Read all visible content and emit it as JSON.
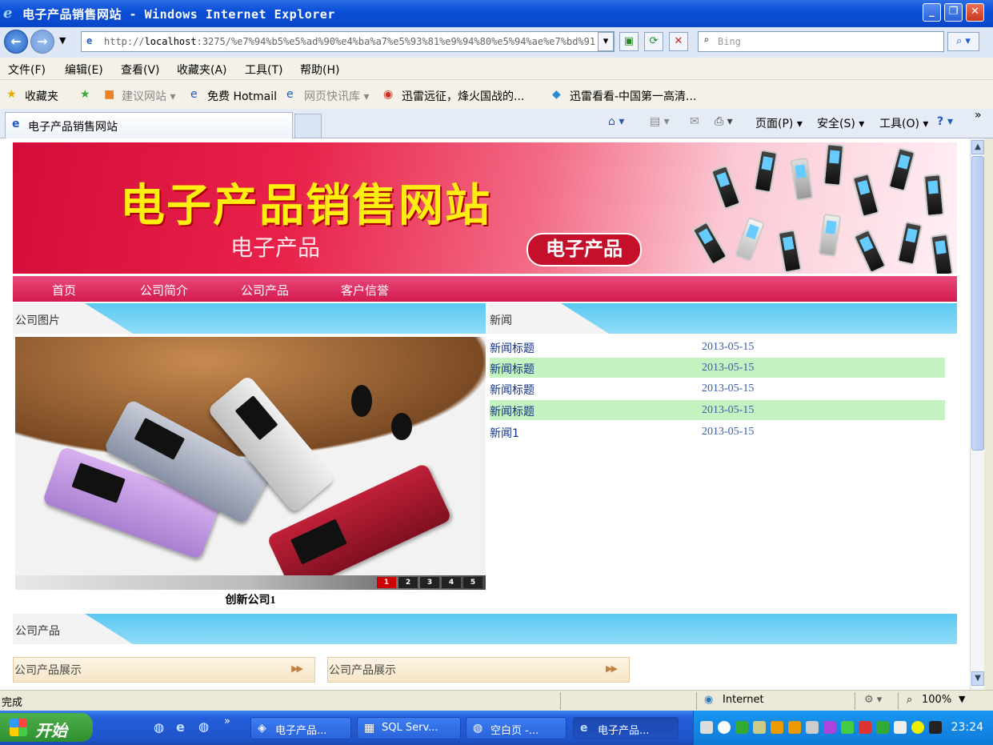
{
  "window": {
    "title": "电子产品销售网站 - Windows Internet Explorer"
  },
  "address": {
    "url_prefix": "http://",
    "url_host": "localhost",
    "url_rest": ":3275/%e7%94%b5%e5%ad%90%e4%ba%a7%e5%93%81%e9%94%80%e5%94%ae%e7%bd%91",
    "search_placeholder": "Bing"
  },
  "menu": {
    "items": [
      "文件(F)",
      "编辑(E)",
      "查看(V)",
      "收藏夹(A)",
      "工具(T)",
      "帮助(H)"
    ]
  },
  "favorites": {
    "label": "收藏夹",
    "items": [
      "建议网站 ▾",
      "免费 Hotmail",
      "网页快讯库 ▾",
      "迅雷远征，烽火国战的...",
      "迅雷看看-中国第一高清..."
    ]
  },
  "tabs": {
    "active": "电子产品销售网站",
    "tools": [
      "页面(P) ▾",
      "安全(S) ▾",
      "工具(O) ▾"
    ]
  },
  "page": {
    "banner": {
      "title": "电子产品销售网站",
      "subtitle": "电子产品",
      "pill": "电子产品"
    },
    "nav": [
      "首页",
      "公司简介",
      "公司产品",
      "客户信誉"
    ],
    "company_images": {
      "heading": "公司图片",
      "caption": "创新公司1",
      "pages": [
        "1",
        "2",
        "3",
        "4",
        "5"
      ],
      "active_page": "1"
    },
    "news": {
      "heading": "新闻",
      "items": [
        {
          "title": "新闻标题",
          "date": "2013-05-15"
        },
        {
          "title": "新闻标题",
          "date": "2013-05-15"
        },
        {
          "title": "新闻标题",
          "date": "2013-05-15"
        },
        {
          "title": "新闻标题",
          "date": "2013-05-15"
        },
        {
          "title": "新闻1",
          "date": "2013-05-15"
        }
      ]
    },
    "products": {
      "heading": "公司产品",
      "boxes": [
        "公司产品展示",
        "公司产品展示"
      ]
    }
  },
  "status": {
    "text": "完成",
    "zone": "Internet",
    "zoom": "100%"
  },
  "taskbar": {
    "start": "开始",
    "tasks": [
      "电子产品...",
      "SQL Serv...",
      "空白页 -...",
      "电子产品..."
    ],
    "clock": "23:24"
  }
}
